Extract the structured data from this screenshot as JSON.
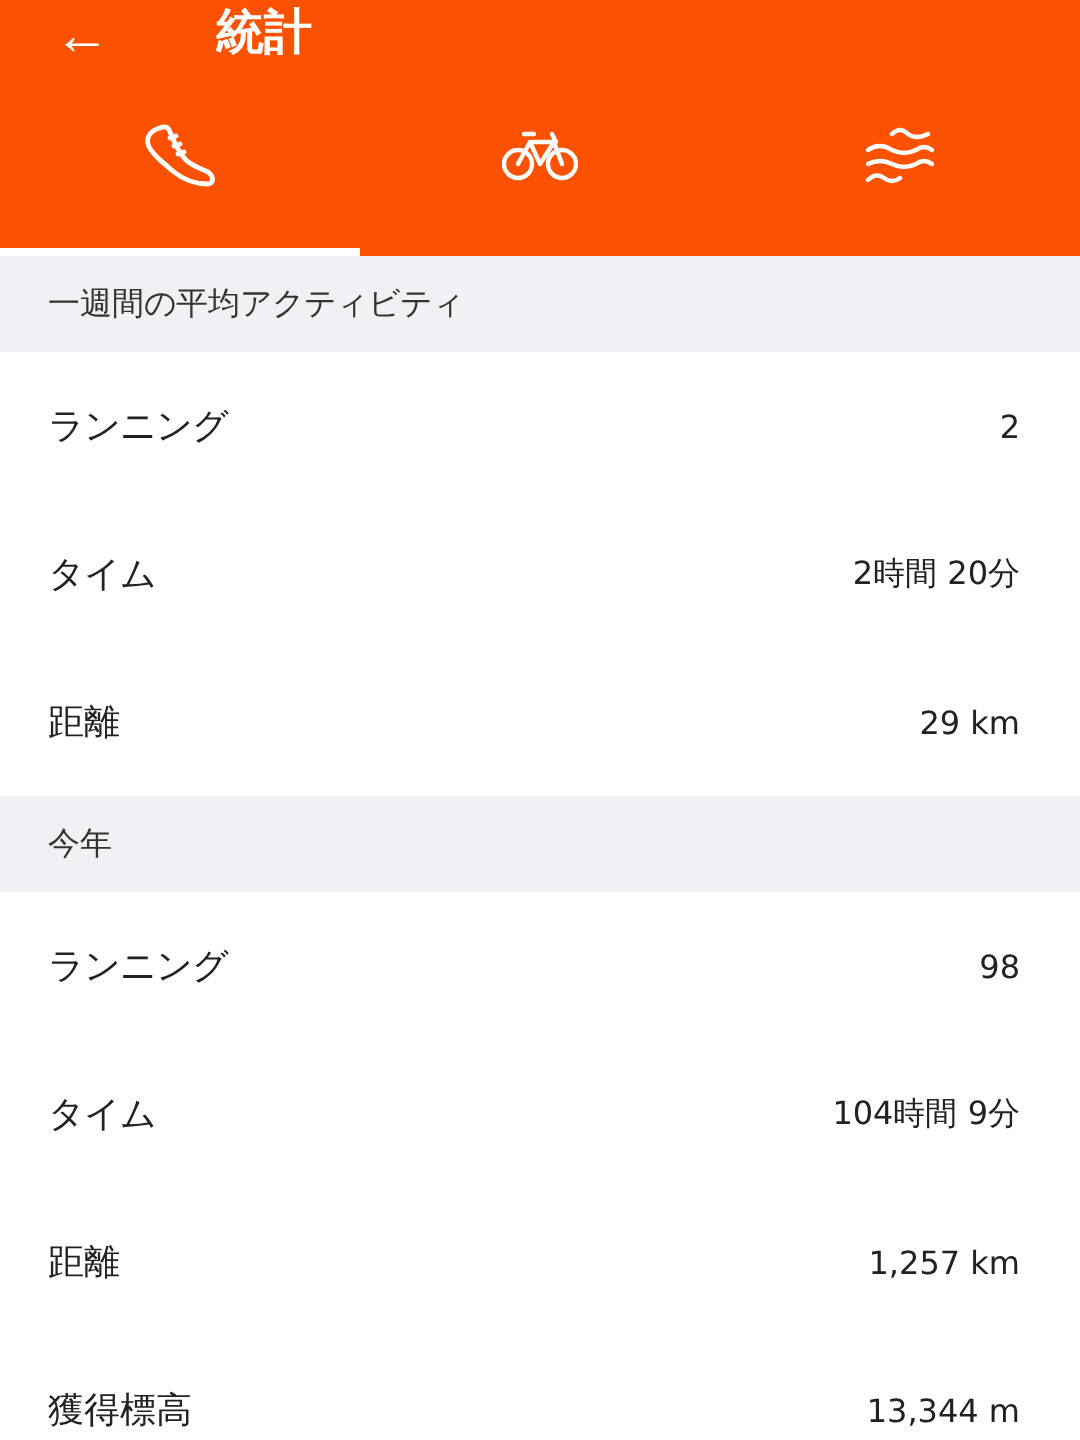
{
  "app_bar": {
    "back": "←",
    "title": "統計"
  },
  "tabs": [
    {
      "kind": "run",
      "selected": true
    },
    {
      "kind": "ride",
      "selected": false
    },
    {
      "kind": "swim",
      "selected": false
    }
  ],
  "sections": [
    {
      "title": "一週間の平均アクティビティ",
      "rows": [
        {
          "label": "ランニング",
          "value": "2"
        },
        {
          "label": "タイム",
          "value": "2時間 20分"
        },
        {
          "label": "距離",
          "value": "29 km"
        }
      ]
    },
    {
      "title": "今年",
      "rows": [
        {
          "label": "ランニング",
          "value": "98"
        },
        {
          "label": "タイム",
          "value": "104時間 9分"
        },
        {
          "label": "距離",
          "value": "1,257 km"
        },
        {
          "label": "獲得標高",
          "value": "13,344 m"
        }
      ]
    }
  ]
}
